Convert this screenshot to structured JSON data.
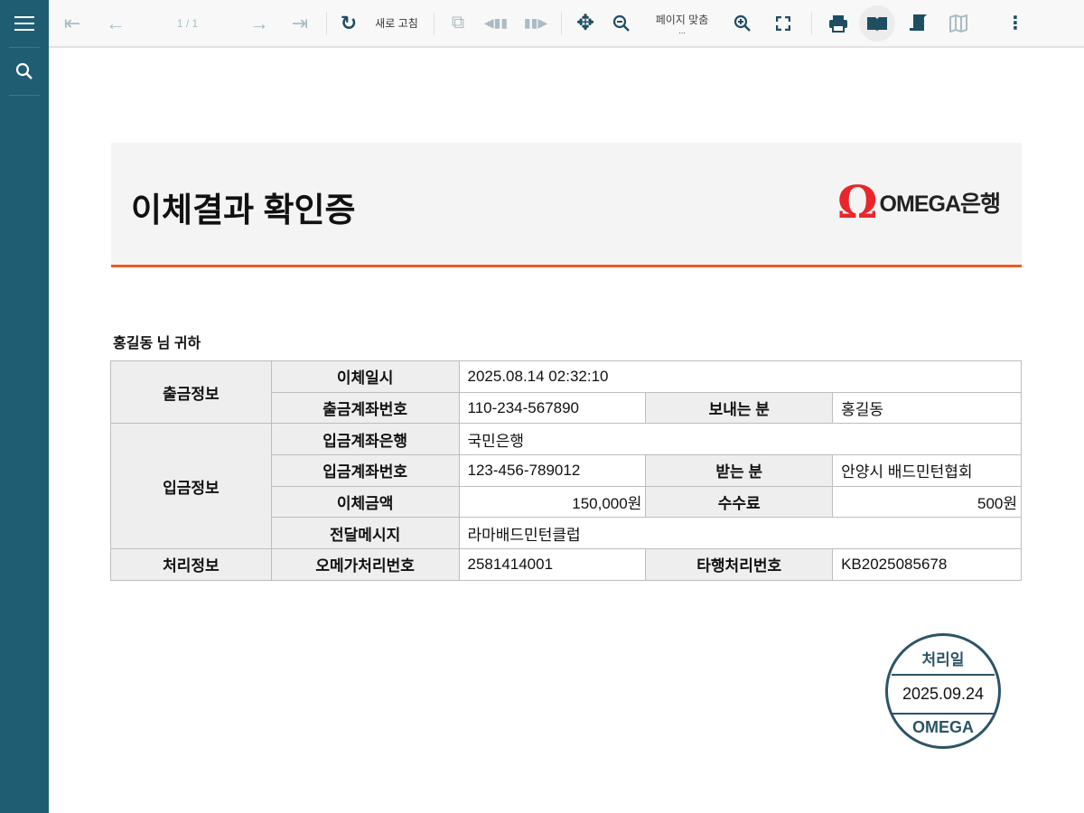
{
  "toolbar": {
    "page": "1 / 1",
    "refresh": "새로 고침",
    "zoom": "페이지 맞춤",
    "zoom_more": "..."
  },
  "document": {
    "title": "이체결과 확인증",
    "logo_text": "OMEGA은행",
    "recipient": "홍길동 님 귀하",
    "table": {
      "g1": "출금정보",
      "g2": "입금정보",
      "g3": "처리정보",
      "transfer_date_label": "이체일시",
      "transfer_date": "2025.08.14 02:32:10",
      "out_account_label": "출금계좌번호",
      "out_account": "110-234-567890",
      "sender_label": "보내는 분",
      "sender": "홍길동",
      "in_bank_label": "입금계좌은행",
      "in_bank": "국민은행",
      "in_account_label": "입금계좌번호",
      "in_account": "123-456-789012",
      "receiver_label": "받는 분",
      "receiver": "안양시 배드민턴협회",
      "amount_label": "이체금액",
      "amount": "150,000원",
      "fee_label": "수수료",
      "fee": "500원",
      "memo_label": "전달메시지",
      "memo": "라마배드민턴클럽",
      "omega_no_label": "오메가처리번호",
      "omega_no": "2581414001",
      "other_no_label": "타행처리번호",
      "other_no": "KB2025085678"
    },
    "stamp": {
      "top": "처리일",
      "date": "2025.09.24",
      "bottom": "OMEGA"
    }
  },
  "colors": {
    "sidebar": "#1f5d73",
    "accent": "#ee5a24",
    "logo": "#e8262b",
    "stamp": "#2c5468"
  }
}
